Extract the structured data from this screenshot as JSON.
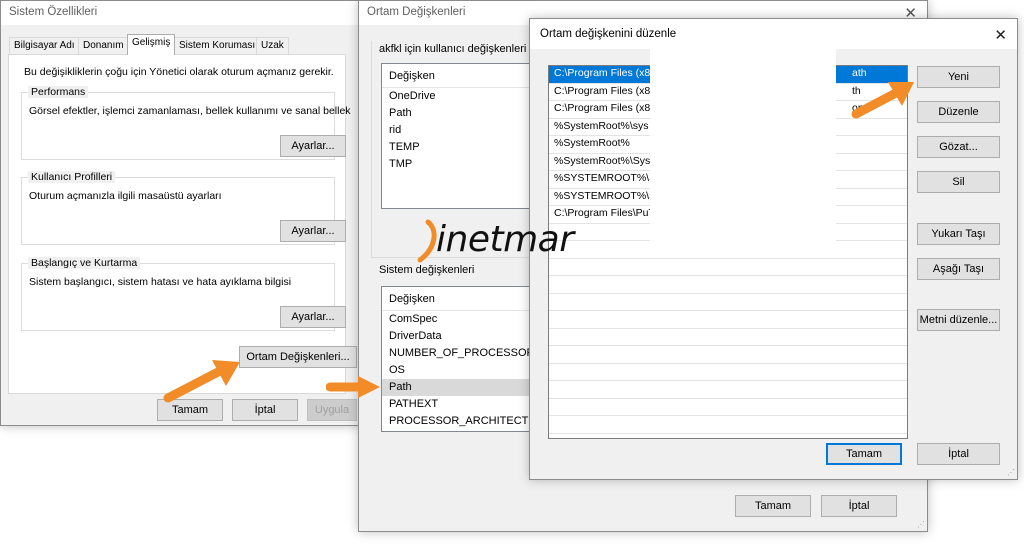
{
  "system_properties": {
    "title": "Sistem Özellikleri",
    "tabs": [
      {
        "label": "Bilgisayar Adı"
      },
      {
        "label": "Donanım"
      },
      {
        "label": "Gelişmiş"
      },
      {
        "label": "Sistem Koruması"
      },
      {
        "label": "Uzak"
      }
    ],
    "admin_note": "Bu değişikliklerin çoğu için Yönetici olarak oturum açmanız gerekir.",
    "performance": {
      "group_label": "Performans",
      "description": "Görsel efektler, işlemci zamanlaması, bellek kullanımı ve sanal bellek",
      "button": "Ayarlar..."
    },
    "user_profiles": {
      "group_label": "Kullanıcı Profilleri",
      "description": "Oturum açmanızla ilgili masaüstü ayarları",
      "button": "Ayarlar..."
    },
    "startup_recovery": {
      "group_label": "Başlangıç ve Kurtarma",
      "description": "Sistem başlangıcı, sistem hatası ve hata ayıklama bilgisi",
      "button": "Ayarlar..."
    },
    "env_button": "Ortam Değişkenleri...",
    "ok": "Tamam",
    "cancel": "İptal",
    "apply": "Uygula"
  },
  "environment_variables": {
    "title": "Ortam Değişkenleri",
    "user_group_label": "akfkl için kullanıcı değişkenleri",
    "user_vars_header": "Değişken",
    "user_vars": [
      "OneDrive",
      "Path",
      "rid",
      "TEMP",
      "TMP"
    ],
    "system_group_label": "Sistem değişkenleri",
    "system_vars_header": "Değişken",
    "system_vars": [
      "ComSpec",
      "DriverData",
      "NUMBER_OF_PROCESSORS",
      "OS",
      "Path",
      "PATHEXT",
      "PROCESSOR_ARCHITECTURE"
    ],
    "system_selected_index": 4,
    "ok": "Tamam",
    "cancel": "İptal"
  },
  "edit_variable": {
    "title": "Ortam değişkenini düzenle",
    "entries": [
      {
        "visible": "C:\\Program Files (x8",
        "tail": "ath"
      },
      {
        "visible": "C:\\Program Files (x8",
        "tail": "th"
      },
      {
        "visible": "C:\\Program Files (x8",
        "tail": "on"
      },
      {
        "visible": "%SystemRoot%\\sys",
        "tail": ""
      },
      {
        "visible": "%SystemRoot%",
        "tail": ""
      },
      {
        "visible": "%SystemRoot%\\Sys",
        "tail": ""
      },
      {
        "visible": "%SYSTEMROOT%\\S",
        "tail": ""
      },
      {
        "visible": "%SYSTEMROOT%\\S",
        "tail": ""
      },
      {
        "visible": "C:\\Program Files\\PuTTY\\",
        "tail": ""
      }
    ],
    "selected_index": 0,
    "buttons": {
      "new": "Yeni",
      "edit": "Düzenle",
      "browse": "Gözat...",
      "delete": "Sil",
      "move_up": "Yukarı Taşı",
      "move_down": "Aşağı Taşı",
      "edit_text": "Metni düzenle...",
      "ok": "Tamam",
      "cancel": "İptal"
    }
  },
  "watermark": {
    "text": "inetmar"
  },
  "colors": {
    "accent": "#0078d7",
    "arrow": "#f28c28",
    "logo_orange": "#f28c28",
    "logo_dark": "#111111"
  }
}
